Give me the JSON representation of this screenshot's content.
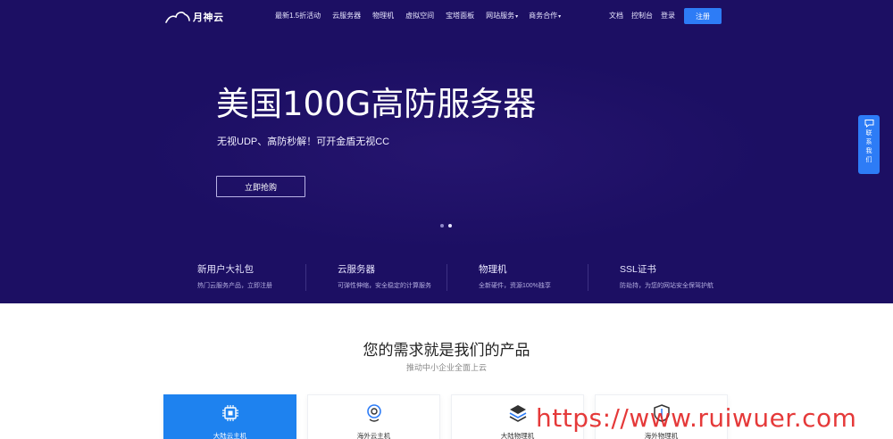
{
  "brand": {
    "name": "月神云"
  },
  "nav": {
    "items": [
      {
        "label": "最新1.5折活动",
        "caret": ""
      },
      {
        "label": "云服务器",
        "caret": ""
      },
      {
        "label": "物理机",
        "caret": ""
      },
      {
        "label": "虚拟空间",
        "caret": ""
      },
      {
        "label": "宝塔面板",
        "caret": ""
      },
      {
        "label": "网站服务",
        "caret": "▾"
      },
      {
        "label": "商务合作",
        "caret": "▾"
      }
    ],
    "right": {
      "docs": "文档",
      "console": "控制台",
      "login": "登录",
      "register": "注册"
    }
  },
  "hero": {
    "title": "美国100G高防服务器",
    "subtitle": "无视UDP、高防秒解！可开金盾无视CC",
    "cta": "立即抢购"
  },
  "features": [
    {
      "title": "新用户大礼包",
      "desc": "热门云服务产品，立即注册"
    },
    {
      "title": "云服务器",
      "desc": "可弹性伸缩，安全稳定的计算服务"
    },
    {
      "title": "物理机",
      "desc": "全新硬件，资源100%独享"
    },
    {
      "title": "SSL证书",
      "desc": "防劫持，为您的网站安全保驾护航"
    }
  ],
  "side_contact": {
    "label": "联系我们"
  },
  "products": {
    "title": "您的需求就是我们的产品",
    "subtitle": "推动中小企业全面上云",
    "cards": [
      {
        "label": "大陆云主机",
        "icon": "chip-icon"
      },
      {
        "label": "海外云主机",
        "icon": "location-icon"
      },
      {
        "label": "大陆物理机",
        "icon": "layers-icon"
      },
      {
        "label": "海外物理机",
        "icon": "shield-icon"
      }
    ]
  },
  "watermark": "https://www.ruiwuer.com",
  "colors": {
    "hero_bg": "#1c0f63",
    "accent": "#2d7cf6",
    "active_card": "#1e82ef",
    "watermark": "#e11e1e"
  }
}
